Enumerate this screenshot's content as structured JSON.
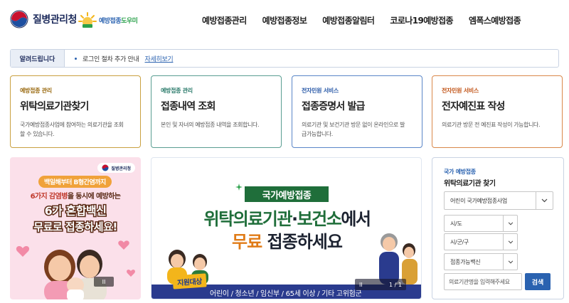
{
  "header": {
    "org_name": "질병관리청",
    "helper_logo": {
      "part1": "예방접종",
      "part2": "도우미"
    },
    "nav": [
      "예방접종관리",
      "예방접종정보",
      "예방접종알림터",
      "코로나19예방접종",
      "엠폭스예방접종"
    ]
  },
  "notice": {
    "badge": "알려드립니다",
    "text": "로그인 절차 추가 안내",
    "link": "자세히보기"
  },
  "cards": [
    {
      "category": "예방접종 관리",
      "title": "위탁의료기관찾기",
      "desc": "국가예방접종사업에 참여하는 의료기관을 조회할 수 있습니다.",
      "accent": "#c9a040"
    },
    {
      "category": "예방접종 관리",
      "title": "접종내역 조회",
      "desc": "본인 및 자녀의 예방접종 내역을 조회합니다.",
      "accent": "#5a9e92"
    },
    {
      "category": "전자민원 서비스",
      "title": "접종증명서 발급",
      "desc": "의료기관 및 보건기관 방문 없이 온라인으로 발급가능합니다.",
      "accent": "#5a86c8"
    },
    {
      "category": "전자민원 서비스",
      "title": "전자예진표 작성",
      "desc": "의료기관 방문 전 예진표 작성이 가능합니다.",
      "accent": "#d9884a"
    }
  ],
  "banner_left": {
    "org": "질병관리청",
    "pill": "백일해부터 B형간염까지",
    "line1_pre": "6가지 감염병",
    "line1_post": "을 동시에 예방하는",
    "line2": "6가 혼합백신",
    "line3": "무료로 접종하세요!",
    "pause": "II"
  },
  "banner_center": {
    "tag": "국가예방접종",
    "title1_a": "위탁의료기관",
    "title1_b": "·",
    "title1_c": "보건소",
    "title1_d": "에서",
    "title2_a": "무료",
    "title2_b": " 접종하세요",
    "badge": "지원대상",
    "targets": "어린이 / 청소년 / 임신부 / 65세 이상 / 기타 고위험군",
    "pause": "II",
    "page": "1 / 1"
  },
  "search": {
    "category": "국가 예방접종",
    "title": "위탁의료기관 찾기",
    "program": "어린이 국가예방접종사업",
    "sido": "시/도",
    "sigungu": "시/군/구",
    "vaccine": "접종가능백신",
    "placeholder": "의료기관명을 입력해주세요",
    "button": "검색"
  },
  "colors": {
    "brand_navy": "#1d2b5c",
    "accent_blue": "#2a62b0",
    "banner_green": "#1f6e3a",
    "banner_bar": "#2a3b8e"
  }
}
